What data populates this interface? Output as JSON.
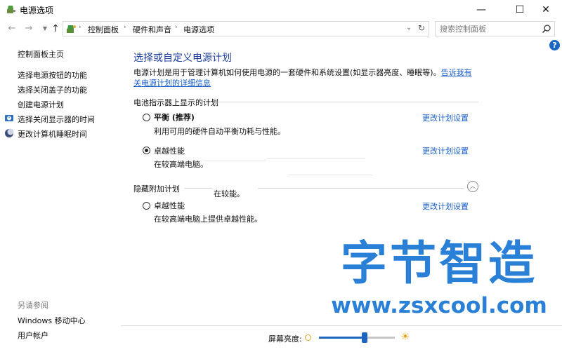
{
  "window": {
    "title": "电源选项",
    "controls": {
      "minimize": "—",
      "maximize": "☐",
      "close": "✕"
    }
  },
  "address": {
    "breadcrumb": [
      "控制面板",
      "硬件和声音",
      "电源选项"
    ],
    "search_placeholder": "搜索控制面板"
  },
  "sidebar": {
    "home": "控制面板主页",
    "links": [
      "选择电源按钮的功能",
      "选择关闭盖子的功能",
      "创建电源计划",
      "选择关闭显示器的时间",
      "更改计算机睡眠时间"
    ],
    "see_also_title": "另请参阅",
    "see_also": [
      "Windows 移动中心",
      "用户帐户"
    ]
  },
  "main": {
    "heading": "选择或自定义电源计划",
    "description": "电源计划是用于管理计算机如何使用电源的一套硬件和系统设置(如显示器亮度、睡眠等)。",
    "description_link": "告诉我有关电源计划的详细信息",
    "battery_section": "电池指示器上显示的计划",
    "hidden_section": "隐藏附加计划",
    "plans": [
      {
        "name": "平衡 (推荐)",
        "desc": "利用可用的硬件自动平衡功耗与性能。",
        "change": "更改计划设置",
        "selected": false
      },
      {
        "name": "卓越性能",
        "desc": "在较高端电脑。",
        "change": "更改计划设置",
        "selected": true
      },
      {
        "name": "卓越性能",
        "desc": "在较高端电脑上提供卓越性能。",
        "change": "更改计划设置",
        "selected": false
      }
    ],
    "ghost_text": "在较能。"
  },
  "bottom": {
    "brightness_label": "屏幕亮度:",
    "brightness_level": 0.6
  },
  "watermark": {
    "title": "字节智造",
    "url": "www.zsxcool.com"
  },
  "colors": {
    "heading": "#1e3e9c",
    "link": "#1a5fcc",
    "accent": "#1a66c2",
    "watermark": "#2a7fd6"
  }
}
